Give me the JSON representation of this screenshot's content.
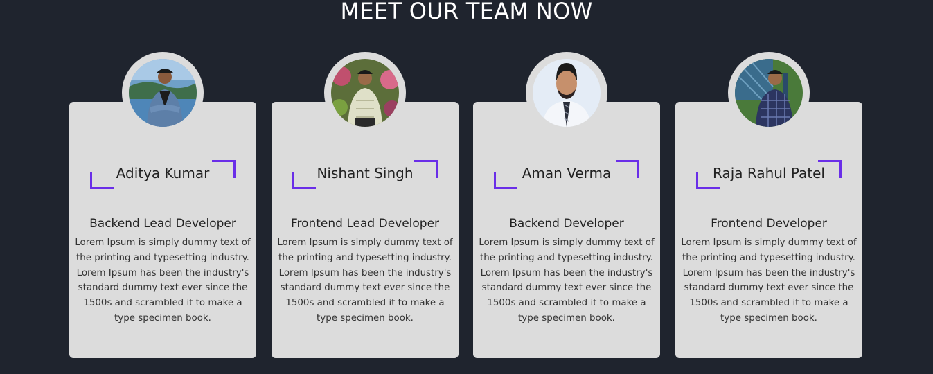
{
  "section": {
    "title": "MEET OUR TEAM NOW"
  },
  "colors": {
    "background": "#1f242e",
    "card": "#dcdcdc",
    "accent": "#6a2ee8"
  },
  "team": [
    {
      "name": "Aditya Kumar",
      "role": "Backend Lead Developer",
      "description": "Lorem Ipsum is simply dummy text of the printing and typesetting industry. Lorem Ipsum has been the industry's standard dummy text ever since the 1500s and scrambled it to make a type specimen book."
    },
    {
      "name": "Nishant Singh",
      "role": "Frontend Lead Developer",
      "description": "Lorem Ipsum is simply dummy text of the printing and typesetting industry. Lorem Ipsum has been the industry's standard dummy text ever since the 1500s and scrambled it to make a type specimen book."
    },
    {
      "name": "Aman Verma",
      "role": "Backend Developer",
      "description": "Lorem Ipsum is simply dummy text of the printing and typesetting industry. Lorem Ipsum has been the industry's standard dummy text ever since the 1500s and scrambled it to make a type specimen book."
    },
    {
      "name": "Raja Rahul Patel",
      "role": "Frontend Developer",
      "description": "Lorem Ipsum is simply dummy text of the printing and typesetting industry. Lorem Ipsum has been the industry's standard dummy text ever since the 1500s and scrambled it to make a type specimen book."
    }
  ]
}
